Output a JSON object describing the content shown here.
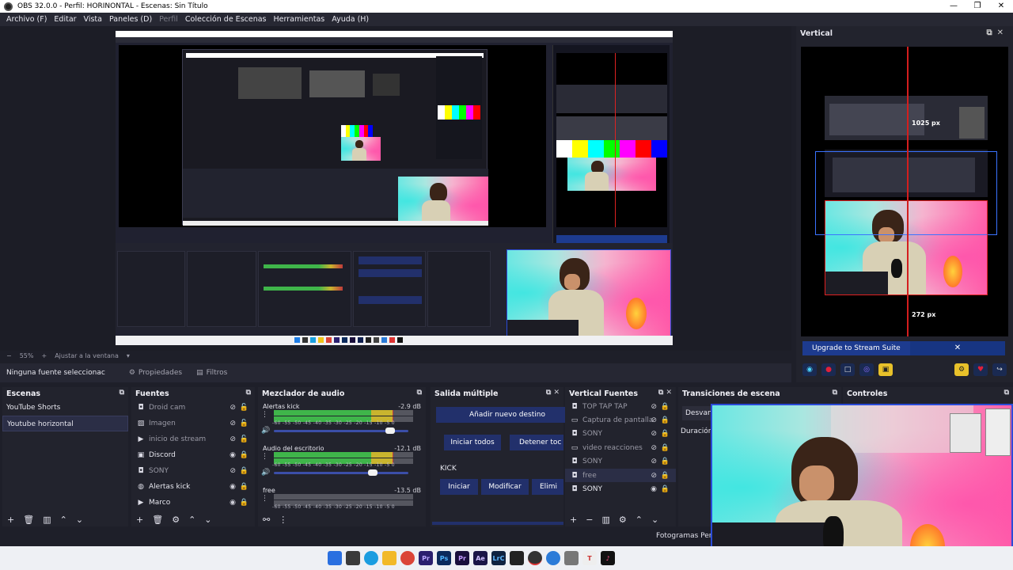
{
  "window": {
    "title": "OBS 32.0.0 - Perfil: HORINONTAL - Escenas: Sin Título",
    "controls": [
      "—",
      "❐",
      "✕"
    ]
  },
  "menu": {
    "items": [
      "Archivo (F)",
      "Editar",
      "Vista",
      "Paneles (D)",
      "Perfil",
      "Colección de Escenas",
      "Herramientas",
      "Ayuda (H)"
    ]
  },
  "zoom": {
    "minus": "−",
    "level": "55%",
    "plus": "+",
    "fit": "Ajustar a la ventana",
    "arrow": "▾"
  },
  "properties_bar": {
    "no_source": "Ninguna fuente seleccionac",
    "properties": "Propiedades",
    "filters": "Filtros"
  },
  "vertical_panel": {
    "title": "Vertical",
    "measure_top": "1025 px",
    "measure_bottom": "272 px",
    "upgrade_label": "Upgrade to Stream Suite",
    "close": "✕"
  },
  "scenes": {
    "title": "Escenas",
    "items": [
      "YouTube Shorts",
      "Youtube horizontal"
    ]
  },
  "sources": {
    "title": "Fuentes",
    "items": [
      {
        "name": "Droid cam",
        "icon": "camera-icon"
      },
      {
        "name": "Imagen",
        "icon": "image-icon"
      },
      {
        "name": "inicio de stream",
        "icon": "play-icon"
      },
      {
        "name": "Discord",
        "icon": "window-icon"
      },
      {
        "name": "SONY",
        "icon": "camera-icon"
      },
      {
        "name": "Alertas kick",
        "icon": "globe-icon"
      },
      {
        "name": "Marco",
        "icon": "play-icon"
      }
    ]
  },
  "mixer": {
    "title": "Mezclador de audio",
    "channels": [
      {
        "name": "Alertas kick",
        "db": "-2.9 dB",
        "level": 0.86,
        "volume": 0.87
      },
      {
        "name": "Audio del escritorio",
        "db": "-12.1 dB",
        "level": 0.86,
        "volume": 0.74
      },
      {
        "name": "free",
        "db": "-13.5 dB",
        "level": 0.0,
        "volume": 0.7
      }
    ],
    "ticks": "-60 -55 -50 -45 -40 -35 -30 -25 -20 -15 -10 -5 0"
  },
  "multi_output": {
    "title": "Salida múltiple",
    "add_dest": "Añadir nuevo destino",
    "start_all": "Iniciar todos",
    "stop_all": "Detener toc",
    "kick": "KICK",
    "start": "Iniciar",
    "modify": "Modificar",
    "delete": "Elimi"
  },
  "vertical_sources": {
    "title": "Vertical Fuentes",
    "items": [
      "TOP TAP TAP",
      "Captura de pantalla",
      "SONY",
      "video reacciones",
      "SONY",
      "free",
      "SONY"
    ]
  },
  "transitions": {
    "title": "Transiciones de escena",
    "fade": "Desvan",
    "duration": "Duración"
  },
  "controls": {
    "title": "Controles"
  },
  "status": {
    "frames": "Fotogramas Perd"
  },
  "taskbar": {
    "icons": [
      "windows-start-icon",
      "file-explorer-icon",
      "edge-icon",
      "folder-icon",
      "chrome-icon",
      "premiere-icon",
      "photoshop-icon",
      "premiere-pro-icon",
      "after-effects-icon",
      "lightroom-icon",
      "capcut-icon",
      "obs-icon",
      "edge-dev-icon",
      "headset-icon",
      "typora-icon",
      "tiktok-icon"
    ],
    "labels": [
      "",
      "",
      "",
      "",
      "",
      "Pr",
      "Ps",
      "Pr",
      "Ae",
      "LrC",
      "",
      "",
      "",
      "",
      "T",
      "♪"
    ]
  },
  "colors": {
    "accent": "#2a4bd8",
    "button": "#22306b",
    "meter_green": "#3fb54a",
    "meter_yellow": "#c9b42e",
    "meter_red": "#c03a3a"
  }
}
